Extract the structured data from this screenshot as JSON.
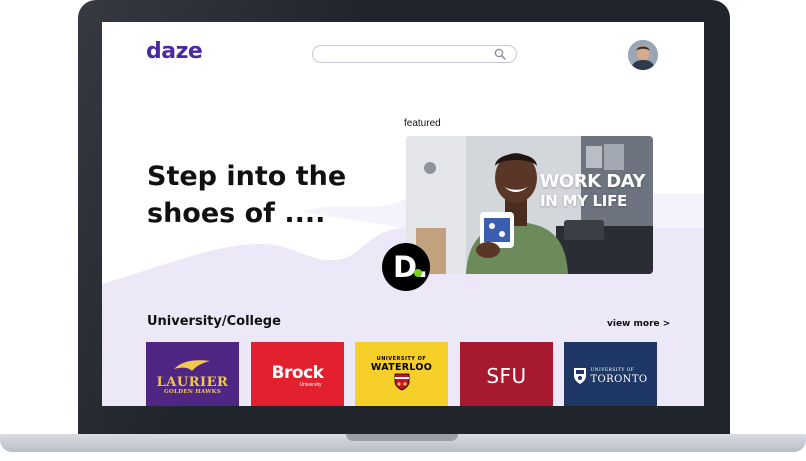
{
  "app": {
    "logo": "daze"
  },
  "header": {
    "search_placeholder": "",
    "search_icon": "search-icon",
    "avatar_icon": "user-avatar"
  },
  "hero": {
    "title": "Step into the shoes of ....",
    "featured_label": "featured",
    "featured_video": {
      "caption_line1": "WORK DAY",
      "caption_line2": "IN MY LIFE",
      "channel_badge_letter": "D.",
      "badge_dot_color": "#7bd321"
    }
  },
  "universities": {
    "section_title": "University/College",
    "view_more_label": "view more >",
    "cards": [
      {
        "name": "Laurier",
        "logo_text": "LAURIER",
        "subtitle": "GOLDEN HAWKS",
        "color": "#4f2683"
      },
      {
        "name": "Brock",
        "logo_text": "Brock",
        "subtitle": "University",
        "color": "#e3202d"
      },
      {
        "name": "Waterloo",
        "logo_prefix": "UNIVERSITY OF",
        "logo_text": "WATERLOO",
        "color": "#f7cf29"
      },
      {
        "name": "SFU",
        "logo_text": "SFU",
        "color": "#a6192e"
      },
      {
        "name": "Toronto",
        "logo_prefix": "UNIVERSITY OF",
        "logo_text": "TORONTO",
        "color": "#1e3765"
      }
    ]
  },
  "colors": {
    "brand": "#4b2aa0",
    "wave": "#ece8f8",
    "frame": "#20242b"
  }
}
